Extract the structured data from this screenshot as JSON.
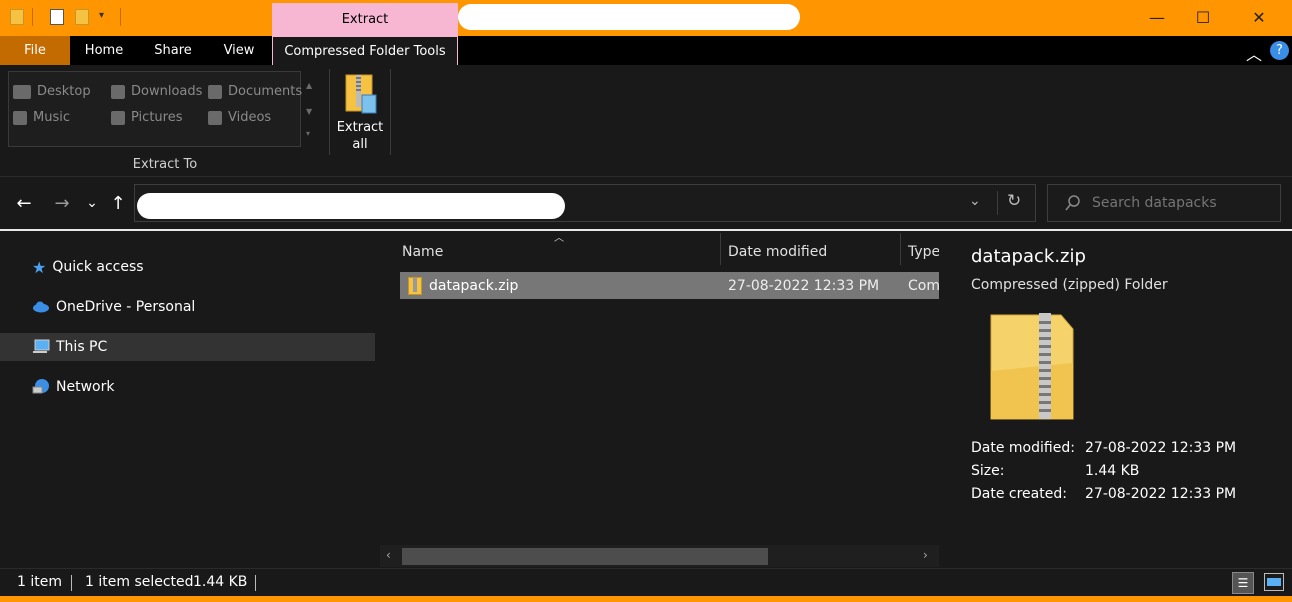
{
  "titlebar": {
    "context_tab": "Extract",
    "minimize": "—",
    "maximize": "☐",
    "close": "✕",
    "accent_color": "#ff9500",
    "context_color": "#f7b6d2"
  },
  "ribbon_tabs": {
    "file": "File",
    "home": "Home",
    "share": "Share",
    "view": "View",
    "compressed": "Compressed Folder Tools",
    "collapse_icon": "chevron-up-icon",
    "help_icon": "help-icon"
  },
  "ribbon": {
    "gallery": [
      {
        "label": "Desktop",
        "icon": "desktop-icon"
      },
      {
        "label": "Downloads",
        "icon": "downloads-icon"
      },
      {
        "label": "Documents",
        "icon": "documents-icon"
      },
      {
        "label": "Music",
        "icon": "music-icon"
      },
      {
        "label": "Pictures",
        "icon": "pictures-icon"
      },
      {
        "label": "Videos",
        "icon": "videos-icon"
      }
    ],
    "group_label": "Extract To",
    "extract_all": "Extract\nall"
  },
  "nav": {
    "back": "←",
    "forward": "→",
    "recent": "⌄",
    "up": "↑",
    "dropdown": "⌄",
    "refresh": "↻",
    "search_placeholder": "Search datapacks"
  },
  "navpane": {
    "items": [
      {
        "label": "Quick access",
        "icon": "star-icon"
      },
      {
        "label": "OneDrive - Personal",
        "icon": "cloud-icon"
      },
      {
        "label": "This PC",
        "icon": "computer-icon"
      },
      {
        "label": "Network",
        "icon": "network-icon"
      }
    ]
  },
  "filelist": {
    "columns": [
      "Name",
      "Date modified",
      "Type"
    ],
    "rows": [
      {
        "name": "datapack.zip",
        "date": "27-08-2022 12:33 PM",
        "type": "Com"
      }
    ]
  },
  "preview": {
    "title": "datapack.zip",
    "subtitle": "Compressed (zipped) Folder",
    "props": [
      {
        "label": "Date modified:",
        "value": "27-08-2022 12:33 PM"
      },
      {
        "label": "Size:",
        "value": "1.44 KB"
      },
      {
        "label": "Date created:",
        "value": "27-08-2022 12:33 PM"
      }
    ]
  },
  "status": {
    "count": "1 item",
    "selected": "1 item selected",
    "size": "1.44 KB"
  }
}
